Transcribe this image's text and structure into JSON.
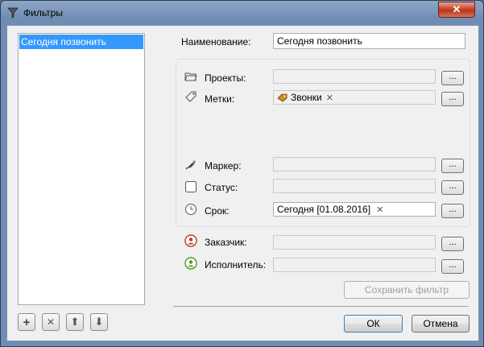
{
  "window": {
    "title": "Фильтры",
    "close_glyph": "✕"
  },
  "filters_list": {
    "items": [
      "Сегодня позвонить"
    ]
  },
  "name_field": {
    "label": "Наименование:",
    "value": "Сегодня позвонить"
  },
  "criteria": {
    "projects": {
      "label": "Проекты:",
      "icon": "folder-icon",
      "value": "",
      "button": "..."
    },
    "tags": {
      "label": "Метки:",
      "icon": "tag-icon",
      "chip": "Звонки",
      "chip_remove": "✕",
      "button": "..."
    },
    "marker": {
      "label": "Маркер:",
      "icon": "marker-icon",
      "value": "",
      "button": "..."
    },
    "status": {
      "label": "Статус:",
      "icon": "checkbox-icon",
      "value": "",
      "button": "..."
    },
    "deadline": {
      "label": "Срок:",
      "icon": "clock-icon",
      "value": "Сегодня [01.08.2016]",
      "remove": "✕",
      "button": "..."
    }
  },
  "people": {
    "customer": {
      "label": "Заказчик:",
      "icon": "customer-icon",
      "value": "",
      "button": "..."
    },
    "executor": {
      "label": "Исполнитель:",
      "icon": "executor-icon",
      "value": "",
      "button": "..."
    }
  },
  "save_filter": {
    "label": "Сохранить фильтр"
  },
  "toolbar": {
    "add": "+",
    "delete": "✕",
    "up": "⬆",
    "down": "⬇"
  },
  "footer": {
    "ok": "ОК",
    "cancel": "Отмена"
  },
  "colors": {
    "selection": "#3399ff",
    "customer_icon": "#c0392b",
    "executor_icon": "#4c9a2a",
    "tag_icon": "#d38b1f"
  }
}
